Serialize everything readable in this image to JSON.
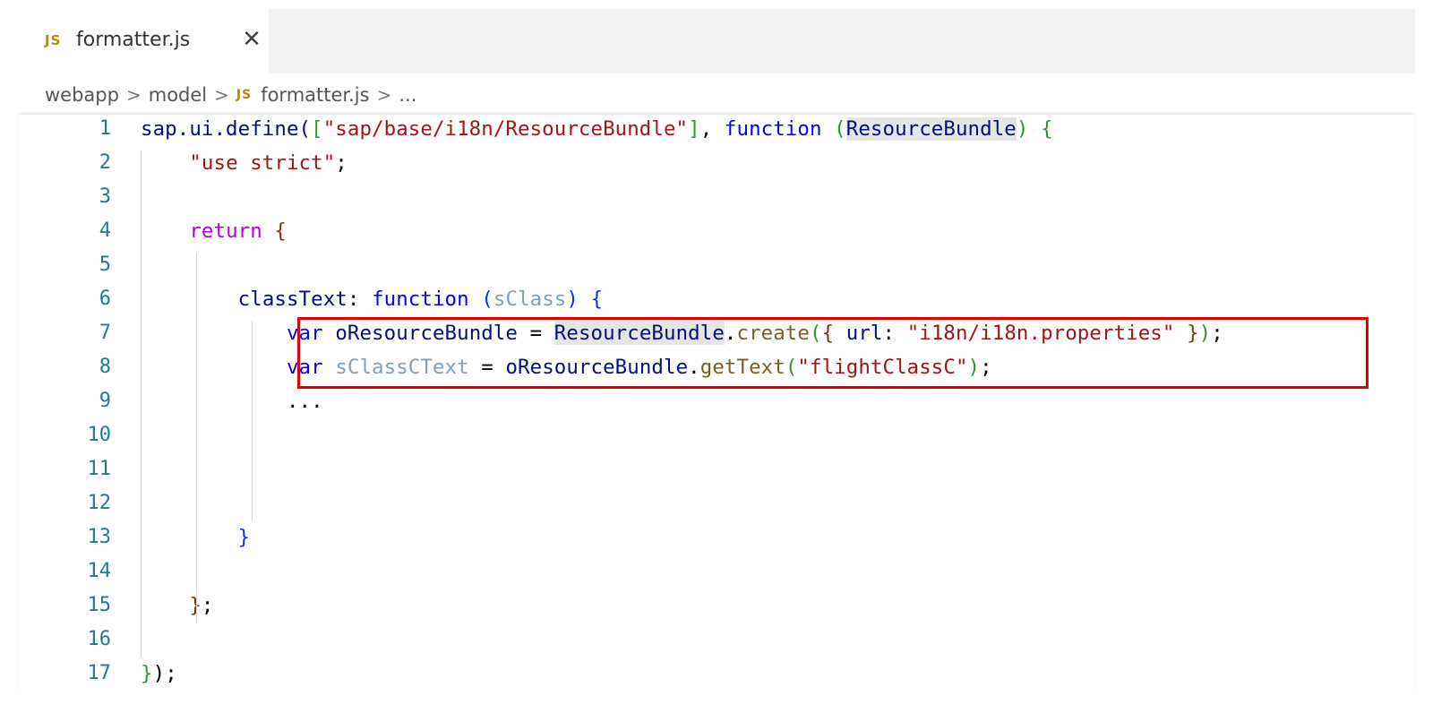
{
  "tab": {
    "icon_text": "JS",
    "label": "formatter.js",
    "close_glyph": "✕"
  },
  "breadcrumb": {
    "items": [
      "webapp",
      "model",
      "formatter.js",
      "..."
    ],
    "file_icon_text": "JS",
    "separator": ">"
  },
  "editor": {
    "line_numbers": [
      "1",
      "2",
      "3",
      "4",
      "5",
      "6",
      "7",
      "8",
      "9",
      "10",
      "11",
      "12",
      "13",
      "14",
      "15",
      "16",
      "17"
    ],
    "lines": [
      {
        "tokens": [
          {
            "t": "sap.ui.define(",
            "c": "tok-ident"
          },
          {
            "t": "[",
            "c": "b2"
          },
          {
            "t": "\"sap/base/i18n/ResourceBundle\"",
            "c": "tok-str"
          },
          {
            "t": "]",
            "c": "b2"
          },
          {
            "t": ", ",
            "c": ""
          },
          {
            "t": "function",
            "c": "tok-kw"
          },
          {
            "t": " ",
            "c": ""
          },
          {
            "t": "(",
            "c": "b2"
          },
          {
            "t": "ResourceBundle",
            "c": "tok-ident tok-hl"
          },
          {
            "t": ")",
            "c": "b2"
          },
          {
            "t": " ",
            "c": ""
          },
          {
            "t": "{",
            "c": "b2"
          }
        ]
      },
      {
        "tokens": [
          {
            "t": "    ",
            "c": ""
          },
          {
            "t": "\"use strict\"",
            "c": "tok-str"
          },
          {
            "t": ";",
            "c": ""
          }
        ]
      },
      {
        "tokens": []
      },
      {
        "tokens": [
          {
            "t": "    ",
            "c": ""
          },
          {
            "t": "return",
            "c": "tok-ctrl"
          },
          {
            "t": " ",
            "c": ""
          },
          {
            "t": "{",
            "c": "b3"
          }
        ]
      },
      {
        "tokens": []
      },
      {
        "tokens": [
          {
            "t": "        ",
            "c": ""
          },
          {
            "t": "classText",
            "c": "tok-ident"
          },
          {
            "t": ": ",
            "c": ""
          },
          {
            "t": "function",
            "c": "tok-kw"
          },
          {
            "t": " ",
            "c": ""
          },
          {
            "t": "(",
            "c": "b1"
          },
          {
            "t": "sClass",
            "c": "tok-unused"
          },
          {
            "t": ")",
            "c": "b1"
          },
          {
            "t": " ",
            "c": ""
          },
          {
            "t": "{",
            "c": "b1"
          }
        ]
      },
      {
        "tokens": [
          {
            "t": "            ",
            "c": ""
          },
          {
            "t": "var",
            "c": "tok-kw"
          },
          {
            "t": " ",
            "c": ""
          },
          {
            "t": "oResourceBundle",
            "c": "tok-ident"
          },
          {
            "t": " = ",
            "c": ""
          },
          {
            "t": "ResourceBundle",
            "c": "tok-ident tok-hl"
          },
          {
            "t": ".",
            "c": ""
          },
          {
            "t": "create",
            "c": "tok-fn"
          },
          {
            "t": "(",
            "c": "b2"
          },
          {
            "t": "{",
            "c": "b3"
          },
          {
            "t": " ",
            "c": ""
          },
          {
            "t": "url",
            "c": "tok-ident"
          },
          {
            "t": ": ",
            "c": ""
          },
          {
            "t": "\"i18n/i18n.properties\"",
            "c": "tok-str"
          },
          {
            "t": " ",
            "c": ""
          },
          {
            "t": "}",
            "c": "b3"
          },
          {
            "t": ")",
            "c": "b2"
          },
          {
            "t": ";",
            "c": ""
          }
        ]
      },
      {
        "tokens": [
          {
            "t": "            ",
            "c": ""
          },
          {
            "t": "var",
            "c": "tok-kw"
          },
          {
            "t": " ",
            "c": ""
          },
          {
            "t": "sClassCText",
            "c": "tok-unused"
          },
          {
            "t": " = ",
            "c": ""
          },
          {
            "t": "oResourceBundle",
            "c": "tok-ident"
          },
          {
            "t": ".",
            "c": ""
          },
          {
            "t": "getText",
            "c": "tok-fn"
          },
          {
            "t": "(",
            "c": "b2"
          },
          {
            "t": "\"flightClassC\"",
            "c": "tok-str"
          },
          {
            "t": ")",
            "c": "b2"
          },
          {
            "t": ";",
            "c": ""
          }
        ]
      },
      {
        "tokens": [
          {
            "t": "            ",
            "c": ""
          },
          {
            "t": "...",
            "c": ""
          }
        ]
      },
      {
        "tokens": []
      },
      {
        "tokens": []
      },
      {
        "tokens": []
      },
      {
        "tokens": [
          {
            "t": "        ",
            "c": ""
          },
          {
            "t": "}",
            "c": "b1"
          }
        ]
      },
      {
        "tokens": []
      },
      {
        "tokens": [
          {
            "t": "    ",
            "c": ""
          },
          {
            "t": "}",
            "c": "b3"
          },
          {
            "t": ";",
            "c": ""
          }
        ]
      },
      {
        "tokens": []
      },
      {
        "tokens": [
          {
            "t": "}",
            "c": "b2"
          },
          {
            "t": ")",
            "c": ""
          },
          {
            "t": ";",
            "c": ""
          }
        ]
      }
    ]
  },
  "colors": {
    "highlight_box": "#e00000",
    "line_number": "#237893",
    "keyword": "#0000ff",
    "string": "#a31515"
  }
}
